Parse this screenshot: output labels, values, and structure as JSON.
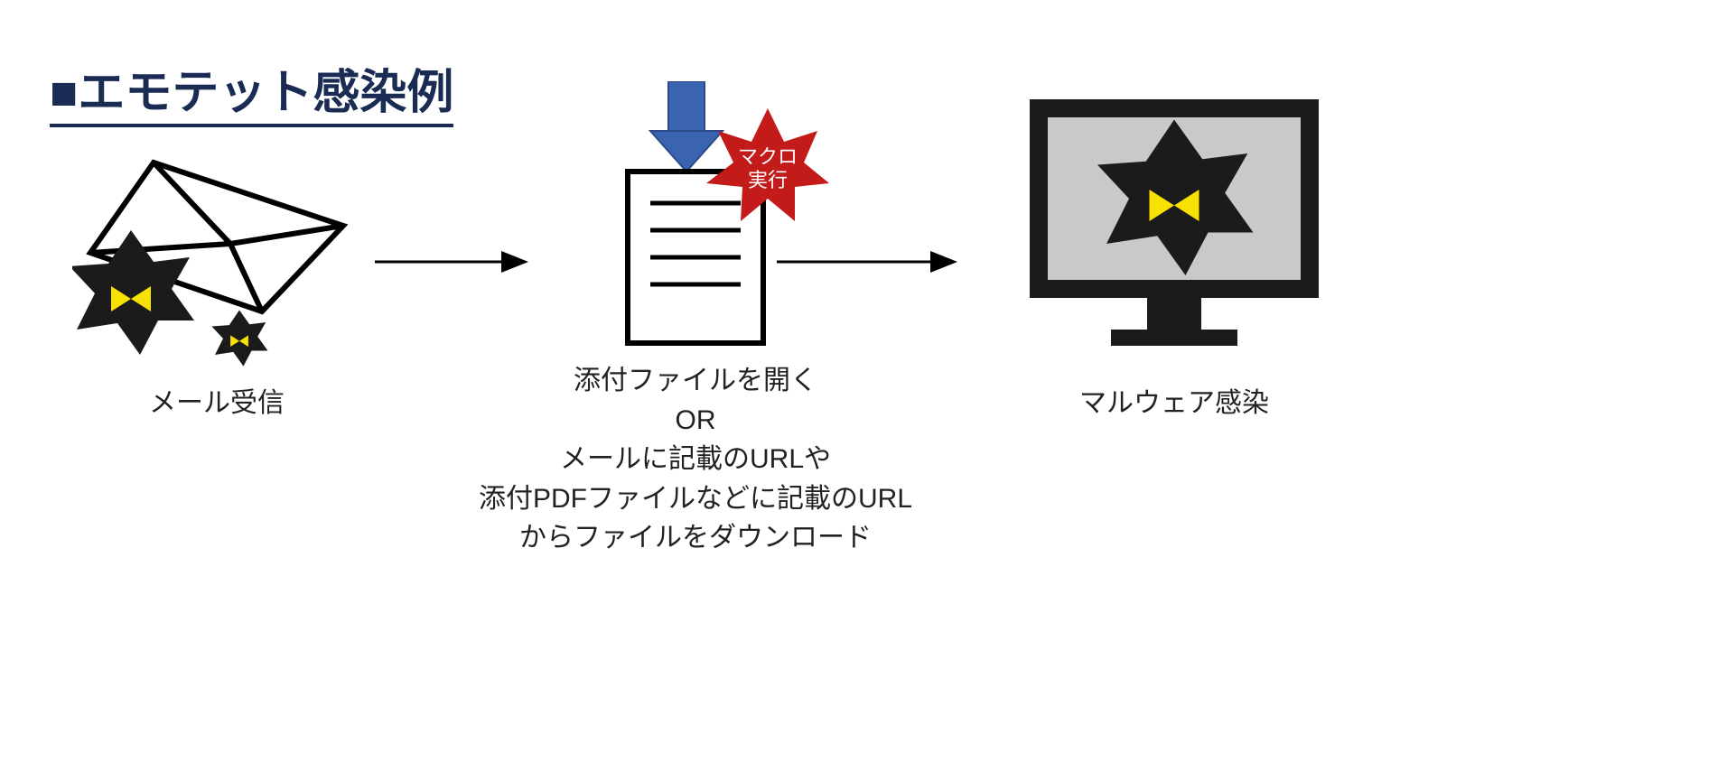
{
  "title": "■エモテット感染例",
  "stage1": {
    "caption": "メール受信"
  },
  "stage2": {
    "badge_line1": "マクロ",
    "badge_line2": "実行",
    "caption_line1": "添付ファイルを開く",
    "caption_line2": "OR",
    "caption_line3": "メールに記載のURLや",
    "caption_line4": "添付PDFファイルなどに記載のURL",
    "caption_line5": "からファイルをダウンロード"
  },
  "stage3": {
    "caption": "マルウェア感染"
  },
  "icons": {
    "envelope": "envelope-icon",
    "malware_star": "malware-star-icon",
    "document": "document-icon",
    "download_arrow": "download-arrow-icon",
    "burst_badge": "burst-badge-icon",
    "monitor": "monitor-icon",
    "flow_arrow": "flow-arrow-icon"
  },
  "colors": {
    "title": "#1a2b54",
    "arrow_blue": "#3a63b0",
    "badge_red": "#c31a1a",
    "star_body": "#1b1b1b",
    "star_eye": "#f7e100",
    "monitor_frame": "#1b1b1b",
    "monitor_screen": "#c9c9c9"
  }
}
